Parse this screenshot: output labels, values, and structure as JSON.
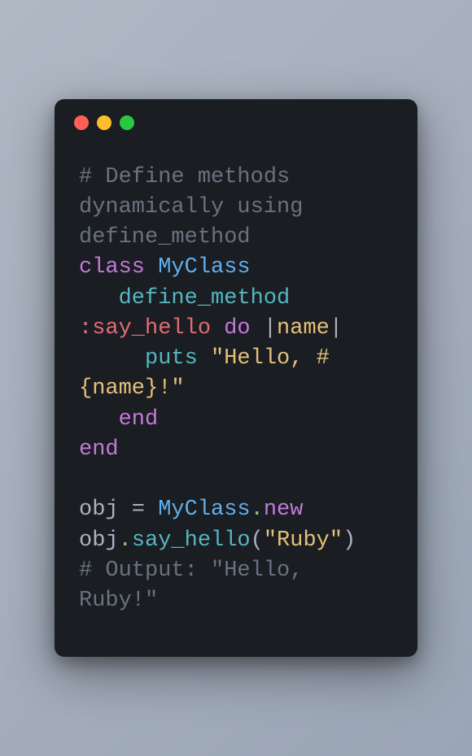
{
  "window": {
    "dots": [
      "red",
      "yellow",
      "green"
    ]
  },
  "code": {
    "lines": [
      {
        "tokens": [
          {
            "t": "# Define methods dynamically using define_method",
            "c": "comment"
          }
        ]
      },
      {
        "tokens": [
          {
            "t": "class",
            "c": "keyword"
          },
          {
            "t": " ",
            "c": "plain"
          },
          {
            "t": "MyClass",
            "c": "class"
          }
        ]
      },
      {
        "tokens": [
          {
            "t": "   ",
            "c": "plain"
          },
          {
            "t": "define_method",
            "c": "method"
          },
          {
            "t": " ",
            "c": "plain"
          },
          {
            "t": ":say_hello",
            "c": "symbol"
          },
          {
            "t": " ",
            "c": "plain"
          },
          {
            "t": "do",
            "c": "keyword"
          },
          {
            "t": " |",
            "c": "plain"
          },
          {
            "t": "name",
            "c": "param"
          },
          {
            "t": "|",
            "c": "plain"
          }
        ]
      },
      {
        "tokens": [
          {
            "t": "     ",
            "c": "plain"
          },
          {
            "t": "puts",
            "c": "method"
          },
          {
            "t": " ",
            "c": "plain"
          },
          {
            "t": "\"Hello, #{name}!\"",
            "c": "string"
          }
        ]
      },
      {
        "tokens": [
          {
            "t": "   ",
            "c": "plain"
          },
          {
            "t": "end",
            "c": "keyword"
          }
        ]
      },
      {
        "tokens": [
          {
            "t": "end",
            "c": "keyword"
          }
        ]
      },
      {
        "tokens": []
      },
      {
        "tokens": [
          {
            "t": "obj",
            "c": "plain"
          },
          {
            "t": " = ",
            "c": "plain"
          },
          {
            "t": "MyClass",
            "c": "class"
          },
          {
            "t": ".",
            "c": "dot-op"
          },
          {
            "t": "new",
            "c": "new-kw"
          }
        ]
      },
      {
        "tokens": [
          {
            "t": "obj",
            "c": "plain"
          },
          {
            "t": ".",
            "c": "dot-op"
          },
          {
            "t": "say_hello",
            "c": "method"
          },
          {
            "t": "(",
            "c": "punct"
          },
          {
            "t": "\"Ruby\"",
            "c": "string"
          },
          {
            "t": ")",
            "c": "punct"
          }
        ]
      },
      {
        "tokens": [
          {
            "t": "# Output: \"Hello, Ruby!\"",
            "c": "comment"
          }
        ]
      }
    ]
  }
}
